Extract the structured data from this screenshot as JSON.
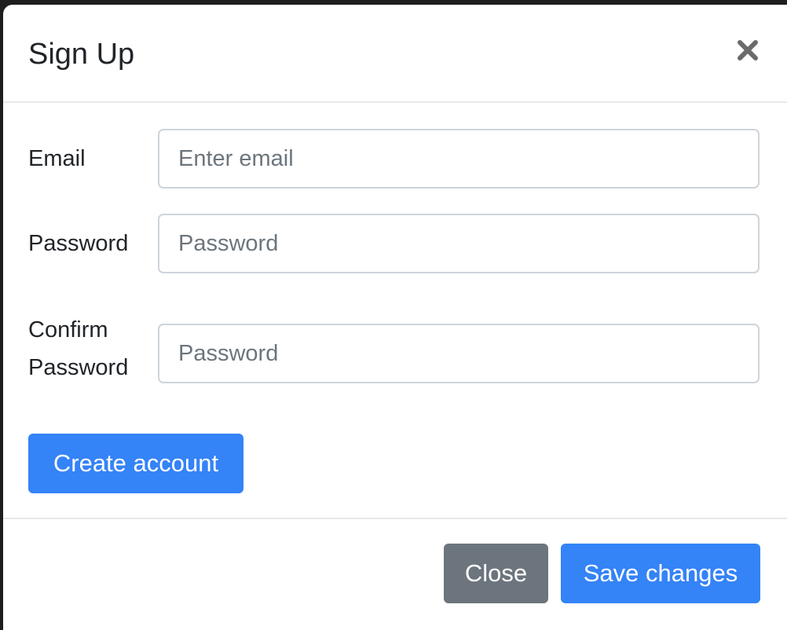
{
  "modal": {
    "title": "Sign Up",
    "close_icon": "close-icon"
  },
  "form": {
    "email": {
      "label": "Email",
      "placeholder": "Enter email",
      "value": ""
    },
    "password": {
      "label": "Password",
      "placeholder": "Password",
      "value": ""
    },
    "confirm_password": {
      "label_line1": "Confirm",
      "label_line2": "Password",
      "placeholder": "Password",
      "value": ""
    },
    "submit_label": "Create account"
  },
  "footer": {
    "close_label": "Close",
    "save_label": "Save changes"
  },
  "colors": {
    "primary": "#3483f7",
    "secondary": "#6c757d",
    "text": "#212529",
    "placeholder": "#6c757d",
    "border": "#ced4da"
  }
}
